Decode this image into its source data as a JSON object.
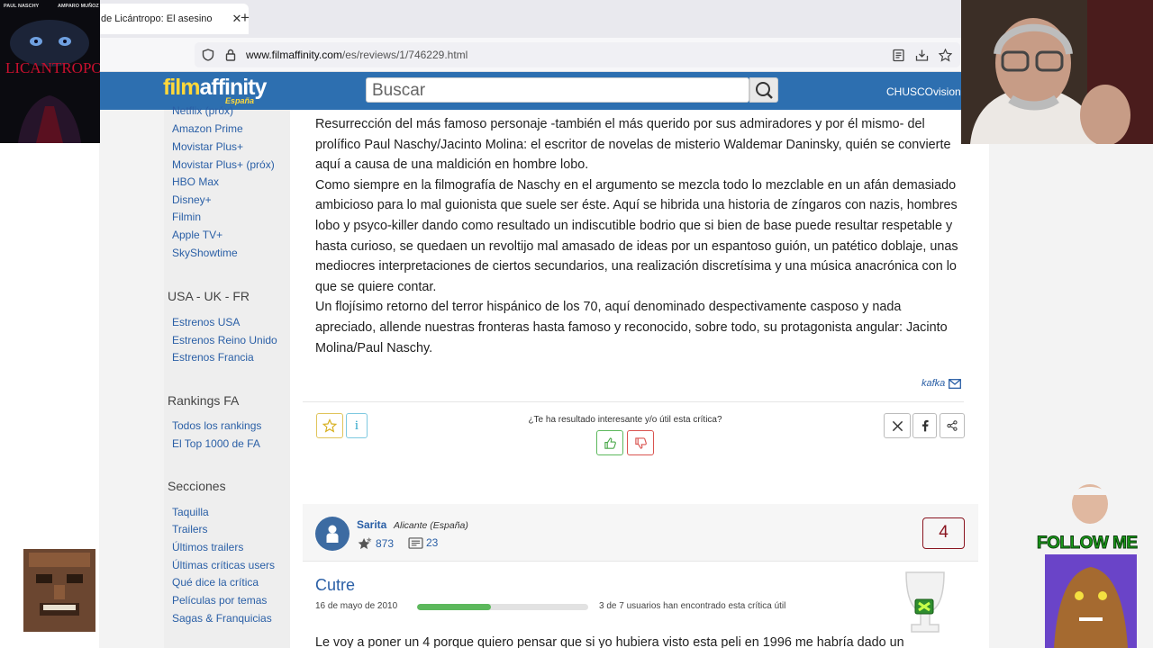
{
  "browser": {
    "tab_title": "de Licántropo: El asesino",
    "url_domain": "www.filmaffinity.com",
    "url_path": "/es/reviews/1/746229.html"
  },
  "site": {
    "logo_part1": "film",
    "logo_part2": "affinity",
    "logo_sub": "España",
    "search_placeholder": "Buscar",
    "username": "CHUSCOvision"
  },
  "sidebar": {
    "platforms": [
      "Netflix (próx)",
      "Amazon Prime",
      "Movistar Plus+",
      "Movistar Plus+ (próx)",
      "HBO Max",
      "Disney+",
      "Filmin",
      "Apple TV+",
      "SkyShowtime"
    ],
    "usa_uk_fr_heading": "USA - UK - FR",
    "usa_uk_fr": [
      "Estrenos USA",
      "Estrenos Reino Unido",
      "Estrenos Francia"
    ],
    "rankings_heading": "Rankings FA",
    "rankings": [
      "Todos los rankings",
      "El Top 1000 de FA"
    ],
    "sections_heading": "Secciones",
    "sections": [
      "Taquilla",
      "Trailers",
      "Últimos trailers",
      "Últimas críticas users",
      "Qué dice la crítica",
      "Películas por temas",
      "Sagas & Franquicias"
    ]
  },
  "review1": {
    "paragraphs": [
      "Resurrección del más famoso personaje -también el más querido por sus admiradores y por él mismo- del prolífico Paul Naschy/Jacinto Molina: el escritor de novelas de misterio Waldemar Daninsky, quién se convierte aquí a causa de una maldición en hombre lobo.",
      "Como siempre en la filmografía de Naschy en el argumento se mezcla todo lo mezclable en un afán demasiado ambicioso para lo mal guionista que suele ser éste. Aquí se hibrida una historia de zíngaros con nazis, hombres lobo y psyco-killer dando como resultado un indiscutible bodrio que si bien de base puede resultar respetable y hasta curioso, se quedaen un revoltijo mal amasado de ideas por un espantoso guión, un patético doblaje, unas mediocres interpretaciones de ciertos secundarios, una realización discretísima y una música anacrónica con lo que se quiere contar.",
      "Un flojísimo retorno del terror hispánico de los 70, aquí denominado despectivamente casposo y nada apreciado, allende nuestras fronteras hasta famoso y reconocido, sobre todo, su protagonista angular: Jacinto Molina/Paul Naschy."
    ],
    "author": "kafka",
    "useful_question": "¿Te ha resultado interesante y/o útil esta crítica?",
    "info_label": "i"
  },
  "review2": {
    "reviewer": "Sarita",
    "location": "Alicante (España)",
    "ratings_count": "873",
    "reviews_count": "23",
    "rating": "4",
    "title": "Cutre",
    "date": "16 de mayo de 2010",
    "useful_fraction": 0.43,
    "useful_text": "3 de 7 usuarios han encontrado esta crítica útil",
    "body_start": "Le voy a poner un 4 porque quiero pensar que si yo hubiera visto esta peli en 1996 me habría dado un"
  },
  "overlays": {
    "poster_actor_left": "PAUL NASCHY",
    "poster_actor_right": "AMPARO MUÑOZ",
    "poster_title": "LICANTROPO",
    "follow_text": "FOLLOW ME"
  },
  "colors": {
    "header_blue": "#2d6fb0",
    "link_blue": "#2a5fa6",
    "logo_yellow": "#ffd83a",
    "rating_red": "#8a1520",
    "useful_green": "#5cb85c"
  }
}
